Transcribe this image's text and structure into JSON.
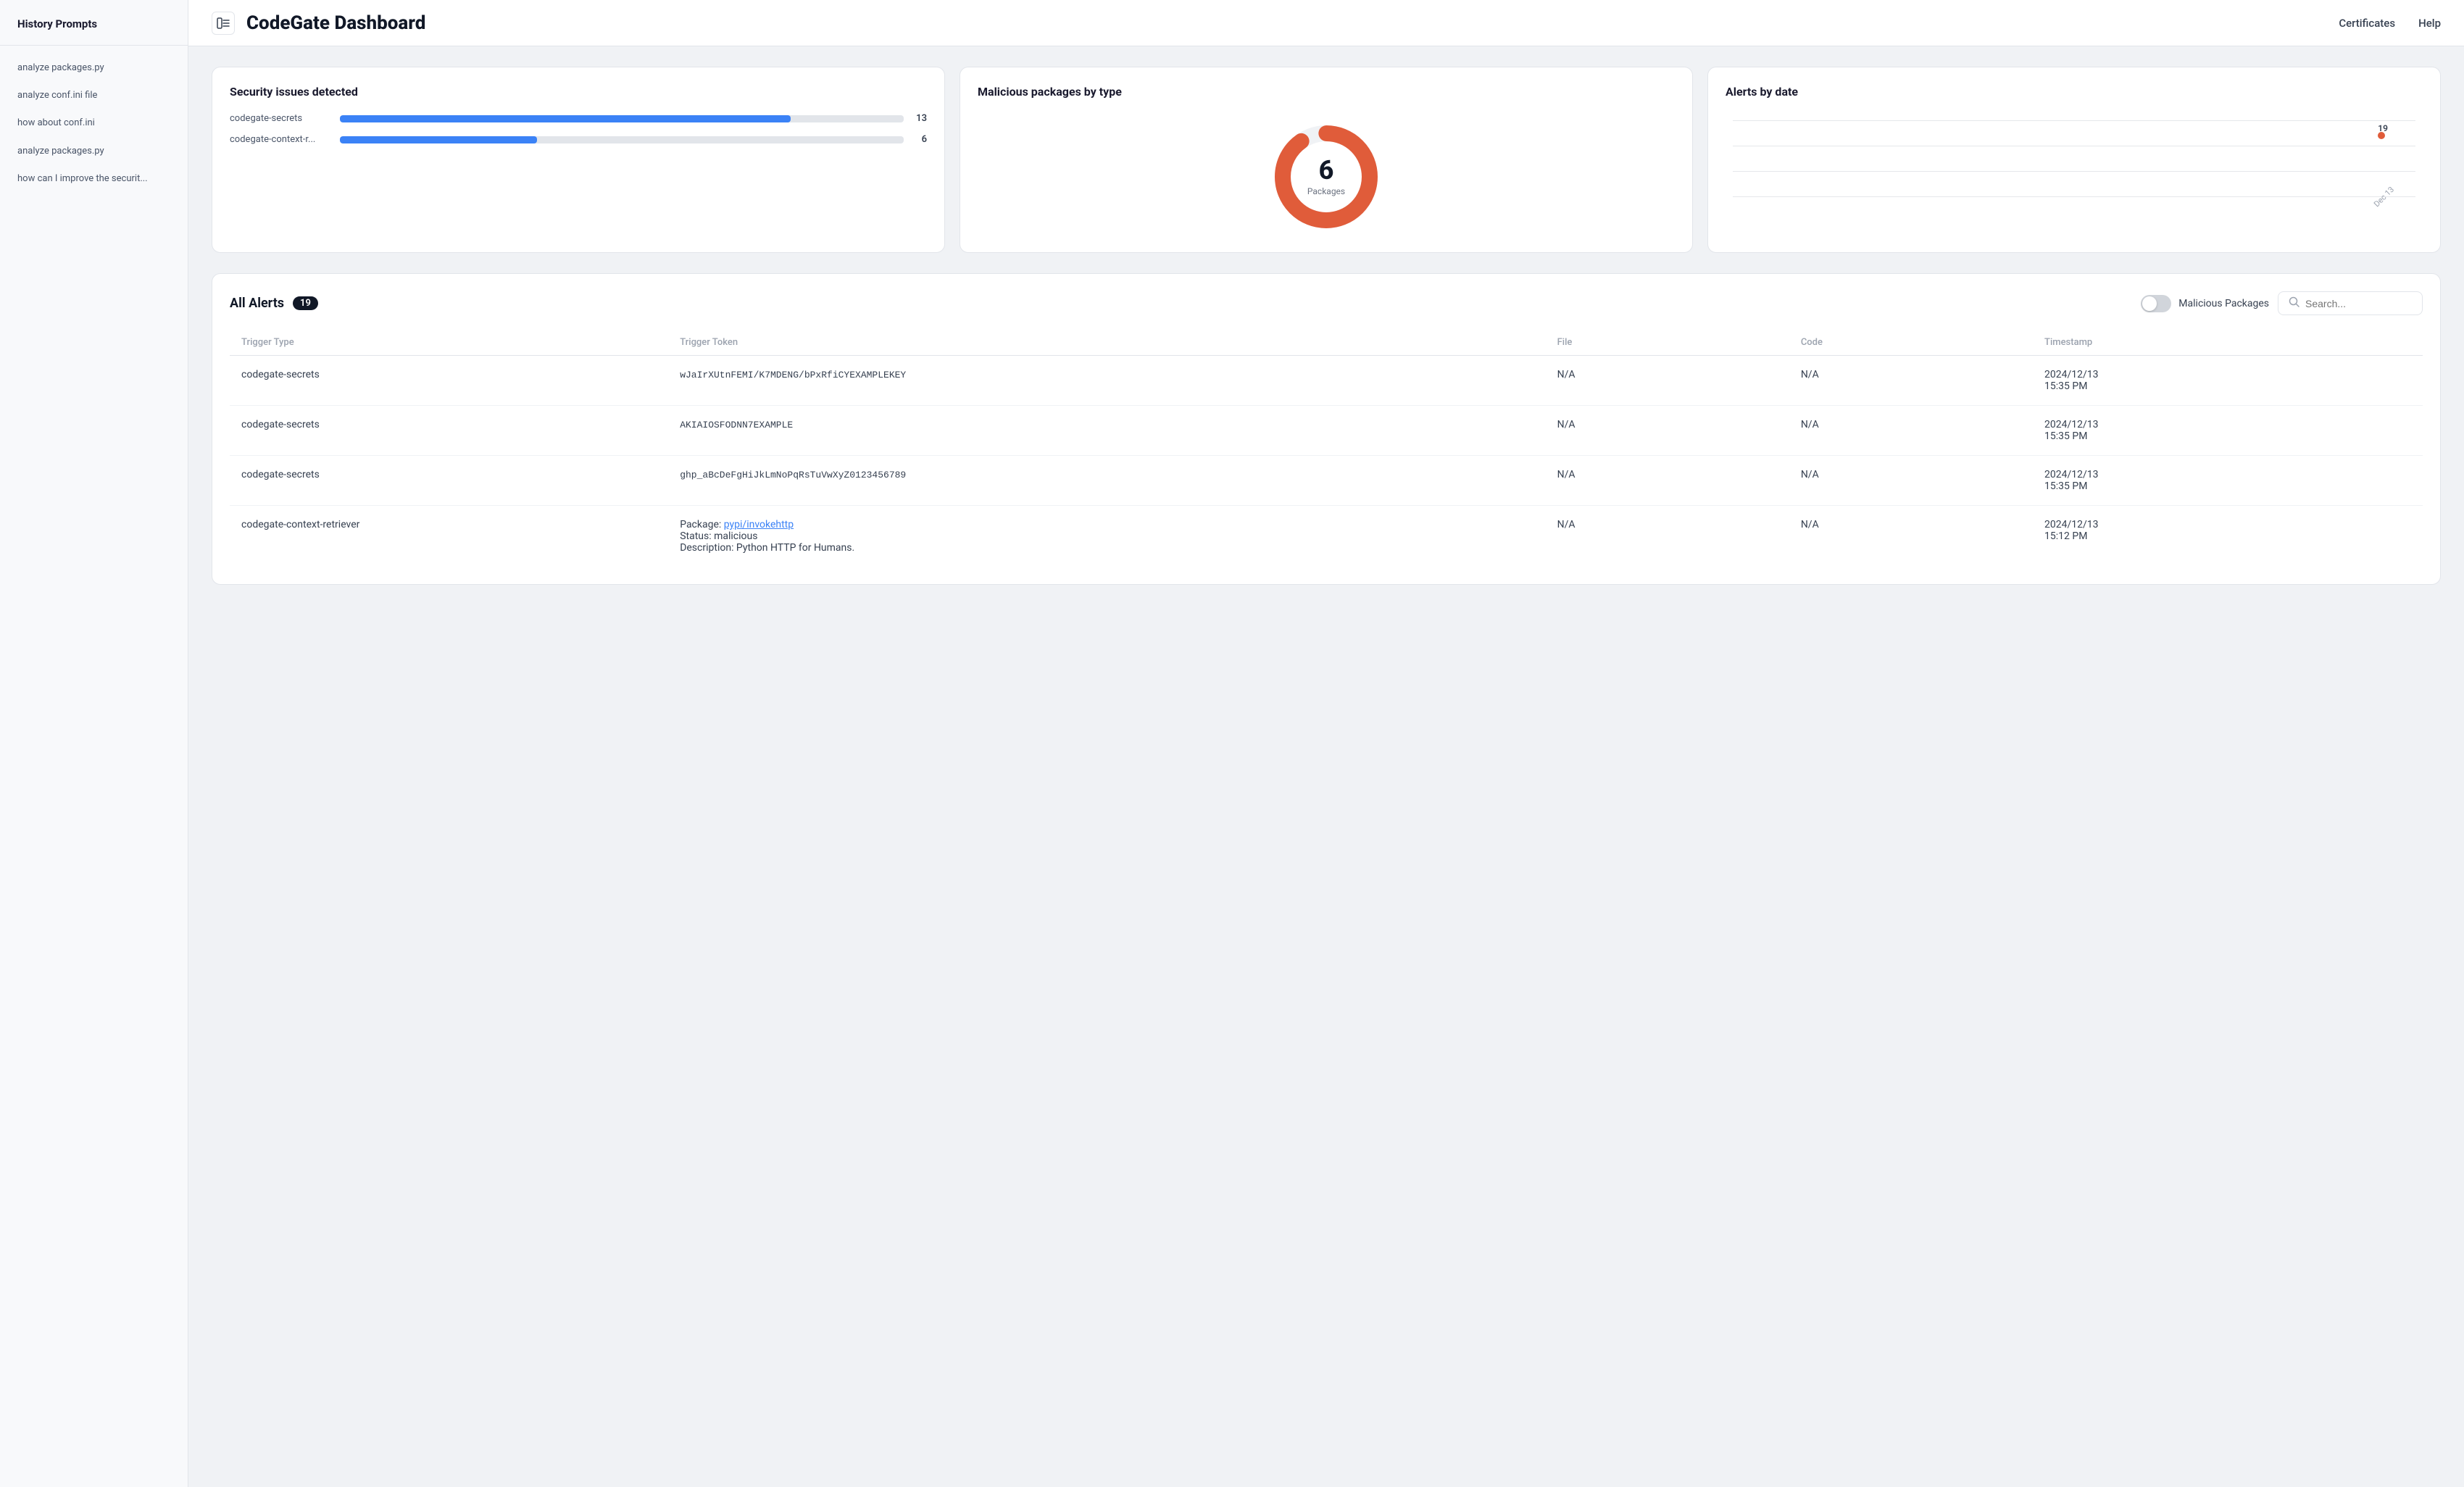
{
  "sidebar": {
    "title": "History Prompts",
    "items": [
      {
        "id": "item-1",
        "label": "analyze packages.py"
      },
      {
        "id": "item-2",
        "label": "analyze conf.ini file"
      },
      {
        "id": "item-3",
        "label": "how about conf.ini"
      },
      {
        "id": "item-4",
        "label": "analyze packages.py"
      },
      {
        "id": "item-5",
        "label": "how can I improve the securit..."
      }
    ]
  },
  "header": {
    "title": "CodeGate Dashboard",
    "toggle_icon": "sidebar-toggle",
    "nav": [
      {
        "id": "nav-certificates",
        "label": "Certificates"
      },
      {
        "id": "nav-help",
        "label": "Help"
      }
    ]
  },
  "summary_cards": {
    "security": {
      "title": "Security issues detected",
      "items": [
        {
          "label": "codegate-secrets",
          "count": 13,
          "fill_pct": 80
        },
        {
          "label": "codegate-context-r...",
          "count": 6,
          "fill_pct": 35
        }
      ]
    },
    "malicious": {
      "title": "Malicious packages by type",
      "donut_value": "6",
      "donut_label": "Packages",
      "donut_color": "#e05c3a",
      "donut_bg": "#f0f2f5"
    },
    "alerts_by_date": {
      "title": "Alerts by date",
      "data_point": {
        "value": 19,
        "x_pct": 78,
        "y_pct": 20
      },
      "x_label": "Dec 13"
    }
  },
  "alerts": {
    "title": "All Alerts",
    "count": 19,
    "toggle_label": "Malicious Packages",
    "search_placeholder": "Search...",
    "columns": [
      {
        "id": "col-trigger",
        "label": "Trigger Type"
      },
      {
        "id": "col-token",
        "label": "Trigger Token"
      },
      {
        "id": "col-file",
        "label": "File"
      },
      {
        "id": "col-code",
        "label": "Code"
      },
      {
        "id": "col-timestamp",
        "label": "Timestamp"
      }
    ],
    "rows": [
      {
        "trigger": "codegate-secrets",
        "token": "wJaIrXUtnFEMI/K7MDENG/bPxRfiCYEXAMPLEKEY",
        "file": "N/A",
        "code": "N/A",
        "timestamp": "2024/12/13\n15:35 PM",
        "is_package": false
      },
      {
        "trigger": "codegate-secrets",
        "token": "AKIAIOSFODNN7EXAMPLE",
        "file": "N/A",
        "code": "N/A",
        "timestamp": "2024/12/13\n15:35 PM",
        "is_package": false
      },
      {
        "trigger": "codegate-secrets",
        "token": "ghp_aBcDeFgHiJkLmNoPqRsTuVwXyZ0123456789",
        "file": "N/A",
        "code": "N/A",
        "timestamp": "2024/12/13\n15:35 PM",
        "is_package": false
      },
      {
        "trigger": "codegate-context-retriever",
        "token_package_prefix": "Package: ",
        "token_package_link": "pypi/invokehttp",
        "token_status": "Status: malicious",
        "token_description": "Description: Python HTTP for Humans.",
        "file": "N/A",
        "code": "N/A",
        "timestamp": "2024/12/13\n15:12 PM",
        "is_package": true
      }
    ]
  }
}
